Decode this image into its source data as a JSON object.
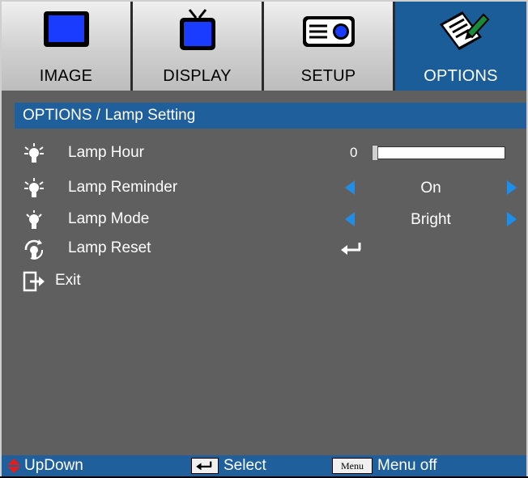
{
  "tabs": [
    {
      "label": "IMAGE",
      "icon": "monitor-icon",
      "active": false
    },
    {
      "label": "DISPLAY",
      "icon": "tv-icon",
      "active": false
    },
    {
      "label": "SETUP",
      "icon": "projector-icon",
      "active": false
    },
    {
      "label": "OPTIONS",
      "icon": "notepad-pencil-icon",
      "active": true
    }
  ],
  "breadcrumb": "OPTIONS / Lamp Setting",
  "rows": {
    "lamp_hour": {
      "label": "Lamp Hour",
      "value": "0",
      "icon": "lamp-bulb-icon",
      "slider_level": 0
    },
    "lamp_reminder": {
      "label": "Lamp Reminder",
      "value": "On",
      "icon": "lamp-bulb-icon"
    },
    "lamp_mode": {
      "label": "Lamp Mode",
      "value": "Bright",
      "icon": "lamp-bulb-icon"
    },
    "lamp_reset": {
      "label": "Lamp Reset",
      "icon": "lamp-reset-icon",
      "action_icon": "enter-icon"
    },
    "exit": {
      "label": "Exit",
      "icon": "exit-icon"
    }
  },
  "footer": {
    "updown": "UpDown",
    "select": "Select",
    "menu_key": "Menu",
    "menu_off": "Menu off"
  },
  "colors": {
    "accent": "#1e5f9c",
    "arrow": "#1e8ee8",
    "background": "#5f5f5f"
  }
}
